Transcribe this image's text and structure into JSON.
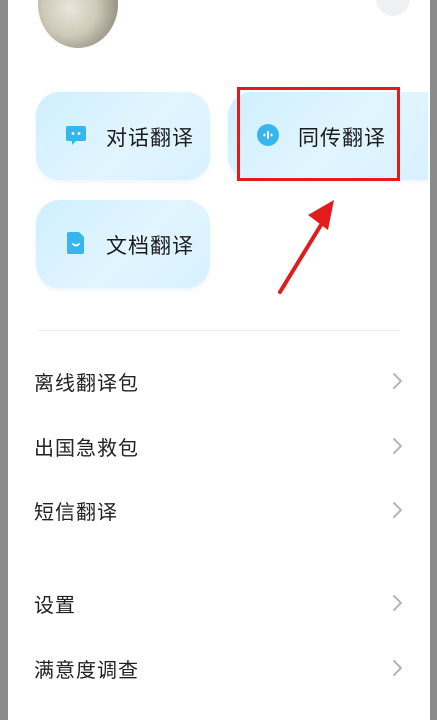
{
  "cards": [
    {
      "label": "对话翻译",
      "icon": "chat-bubble-icon"
    },
    {
      "label": "同传翻译",
      "icon": "voice-wave-icon"
    },
    {
      "label": "文档翻译",
      "icon": "document-icon"
    }
  ],
  "menu": [
    {
      "label": "离线翻译包"
    },
    {
      "label": "出国急救包"
    },
    {
      "label": "短信翻译"
    },
    {
      "label": "设置"
    },
    {
      "label": "满意度调查"
    }
  ],
  "colors": {
    "accent": "#37b6ee",
    "card_bg": "#d6f1ff",
    "annotation_red": "#e21b1b",
    "text": "#222222",
    "chevron": "#b5b5b5"
  }
}
